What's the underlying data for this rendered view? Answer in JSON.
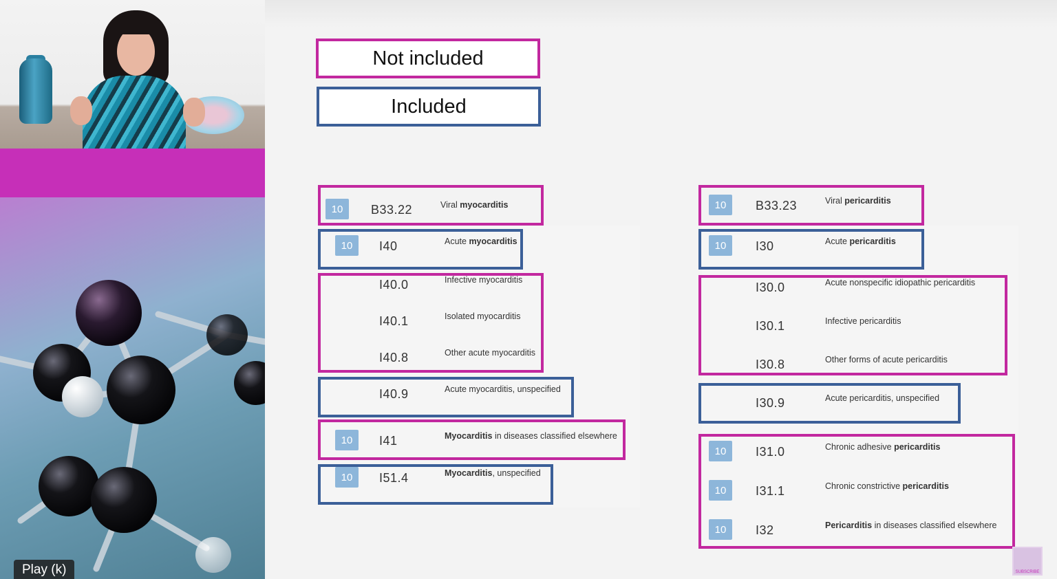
{
  "player": {
    "play_tooltip": "Play (k)"
  },
  "legend": {
    "not_included": "Not included",
    "included": "Included"
  },
  "colors": {
    "not_included": "#c2289f",
    "included": "#3b5f98",
    "badge": "#8db6da",
    "band": "#c62fb8"
  },
  "subscribe_label": "SUBSCRIBE",
  "myocarditis": [
    {
      "badge": "10",
      "code": "B33.22",
      "desc_plain": "Viral ",
      "desc_bold": "myocarditis",
      "desc_tail": ""
    },
    {
      "badge": "10",
      "code": "I40",
      "desc_plain": "Acute ",
      "desc_bold": "myocarditis",
      "desc_tail": ""
    },
    {
      "badge": "",
      "code": "I40.0",
      "desc_plain": "Infective myocarditis",
      "desc_bold": "",
      "desc_tail": ""
    },
    {
      "badge": "",
      "code": "I40.1",
      "desc_plain": "Isolated myocarditis",
      "desc_bold": "",
      "desc_tail": ""
    },
    {
      "badge": "",
      "code": "I40.8",
      "desc_plain": "Other acute myocarditis",
      "desc_bold": "",
      "desc_tail": ""
    },
    {
      "badge": "",
      "code": "I40.9",
      "desc_plain": "Acute myocarditis, unspecified",
      "desc_bold": "",
      "desc_tail": ""
    },
    {
      "badge": "10",
      "code": "I41",
      "desc_plain": "",
      "desc_bold": "Myocarditis",
      "desc_tail": " in diseases classified elsewhere"
    },
    {
      "badge": "10",
      "code": "I51.4",
      "desc_plain": "",
      "desc_bold": "Myocarditis",
      "desc_tail": ", unspecified"
    }
  ],
  "pericarditis": [
    {
      "badge": "10",
      "code": "B33.23",
      "desc_plain": "Viral ",
      "desc_bold": "pericarditis",
      "desc_tail": ""
    },
    {
      "badge": "10",
      "code": "I30",
      "desc_plain": "Acute ",
      "desc_bold": "pericarditis",
      "desc_tail": ""
    },
    {
      "badge": "",
      "code": "I30.0",
      "desc_plain": "Acute nonspecific idiopathic pericarditis",
      "desc_bold": "",
      "desc_tail": ""
    },
    {
      "badge": "",
      "code": "I30.1",
      "desc_plain": "Infective pericarditis",
      "desc_bold": "",
      "desc_tail": ""
    },
    {
      "badge": "",
      "code": "I30.8",
      "desc_plain": "Other forms of acute pericarditis",
      "desc_bold": "",
      "desc_tail": ""
    },
    {
      "badge": "",
      "code": "I30.9",
      "desc_plain": "Acute pericarditis, unspecified",
      "desc_bold": "",
      "desc_tail": ""
    },
    {
      "badge": "10",
      "code": "I31.0",
      "desc_plain": "Chronic adhesive ",
      "desc_bold": "pericarditis",
      "desc_tail": ""
    },
    {
      "badge": "10",
      "code": "I31.1",
      "desc_plain": "Chronic constrictive ",
      "desc_bold": "pericarditis",
      "desc_tail": ""
    },
    {
      "badge": "10",
      "code": "I32",
      "desc_plain": "",
      "desc_bold": "Pericarditis",
      "desc_tail": " in diseases classified elsewhere"
    }
  ]
}
